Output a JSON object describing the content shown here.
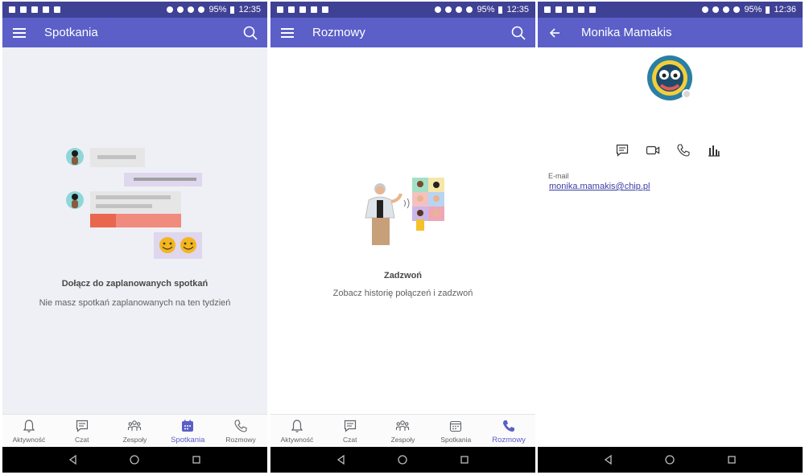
{
  "status": {
    "s1_battery": "95%",
    "s1_time": "12:35",
    "s2_battery": "95%",
    "s2_time": "12:35",
    "s3_battery": "95%",
    "s3_time": "12:36"
  },
  "screens": {
    "meetings": {
      "title": "Spotkania",
      "empty_title": "Dołącz do zaplanowanych spotkań",
      "empty_sub": "Nie masz spotkań zaplanowanych na ten tydzień"
    },
    "calls": {
      "title": "Rozmowy",
      "empty_title": "Zadzwoń",
      "empty_sub": "Zobacz historię połączeń i zadzwoń"
    },
    "profile": {
      "title": "Monika Mamakis",
      "email_label": "E-mail",
      "email_value": "monika.mamakis@chip.pl"
    }
  },
  "tabs": [
    "Aktywność",
    "Czat",
    "Zespoły",
    "Spotkania",
    "Rozmowy"
  ],
  "colors": {
    "appbar": "#5b5fc7",
    "statusbar": "#3f4195",
    "accent": "#5b5fc7",
    "meetings_bg": "#eef0f5"
  },
  "icons": {
    "appbar": [
      "menu-icon",
      "search-icon",
      "back-arrow-icon"
    ],
    "tabs": [
      "bell-icon",
      "chat-icon",
      "teams-icon",
      "calendar-icon",
      "phone-icon"
    ],
    "profile_actions": [
      "chat-icon",
      "video-icon",
      "phone-icon",
      "org-chart-icon"
    ],
    "navbar": [
      "back-triangle-icon",
      "home-circle-icon",
      "recents-square-icon"
    ]
  }
}
